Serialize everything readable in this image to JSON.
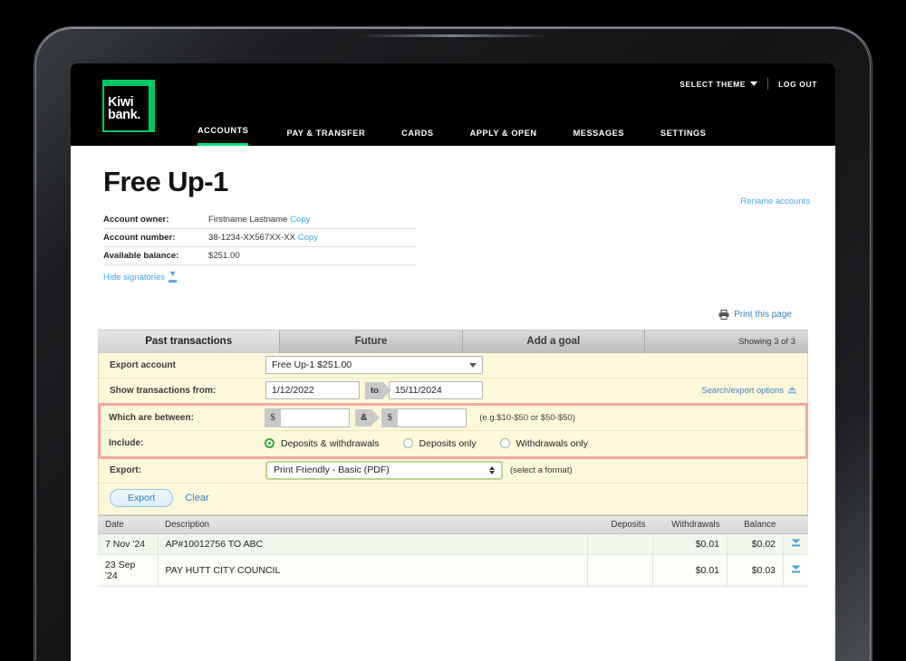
{
  "header": {
    "utility": {
      "select_theme": "SELECT THEME",
      "log_out": "LOG OUT"
    },
    "logo": {
      "line1": "Kiwi",
      "line2": "bank."
    },
    "nav": [
      {
        "label": "ACCOUNTS",
        "active": true
      },
      {
        "label": "PAY & TRANSFER",
        "active": false
      },
      {
        "label": "CARDS",
        "active": false
      },
      {
        "label": "APPLY & OPEN",
        "active": false
      },
      {
        "label": "MESSAGES",
        "active": false
      },
      {
        "label": "SETTINGS",
        "active": false
      }
    ]
  },
  "account": {
    "title": "Free Up-1",
    "rename_link": "Rename accounts",
    "rows": [
      {
        "label": "Account owner:",
        "value": "Firstname Lastname",
        "link": "Copy"
      },
      {
        "label": "Account number:",
        "value": "38-1234-XX567XX-XX",
        "link": "Copy"
      },
      {
        "label": "Available balance:",
        "value": "$251.00",
        "link": ""
      }
    ],
    "signatories_link": "Hide signatories"
  },
  "print_link": "Print this page",
  "tabs": [
    {
      "label": "Past transactions",
      "active": true
    },
    {
      "label": "Future",
      "active": false
    },
    {
      "label": "Add a goal",
      "active": false
    }
  ],
  "showing": "Showing 3 of 3",
  "form": {
    "export_account_label": "Export account",
    "export_account_value": "Free Up-1 $251.00",
    "show_from_label": "Show transactions from:",
    "date_from": "1/12/2022",
    "date_to_chip": "to",
    "date_to": "15/11/2024",
    "search_export_options": "Search/export options",
    "between_label": "Which are between:",
    "amount_min": "",
    "amount_max": "",
    "currency_symbol": "$",
    "amp_chip": "&",
    "amount_hint": "(e.g.$10-$50 or $50-$50)",
    "include_label": "Include:",
    "include_options": [
      {
        "label": "Deposits & withdrawals",
        "selected": true
      },
      {
        "label": "Deposits only",
        "selected": false
      },
      {
        "label": "Withdrawals only",
        "selected": false
      }
    ],
    "export_label": "Export:",
    "export_format_value": "Print Friendly - Basic (PDF)",
    "select_format_note": "(select a format)",
    "export_button": "Export",
    "clear_link": "Clear"
  },
  "table": {
    "columns": [
      "Date",
      "Description",
      "Deposits",
      "Withdrawals",
      "Balance"
    ],
    "rows": [
      {
        "date": "7 Nov '24",
        "description": "AP#10012756 TO ABC",
        "deposits": "",
        "withdrawals": "$0.01",
        "balance": "$0.02"
      },
      {
        "date": "23 Sep '24",
        "description": "PAY HUTT CITY COUNCIL",
        "deposits": "",
        "withdrawals": "$0.01",
        "balance": "$0.03"
      }
    ]
  },
  "colors": {
    "brand_green": "#00c868",
    "link_blue": "#3da6e3",
    "highlight_red": "#f5a6a0",
    "form_bg": "#fcf8da"
  }
}
